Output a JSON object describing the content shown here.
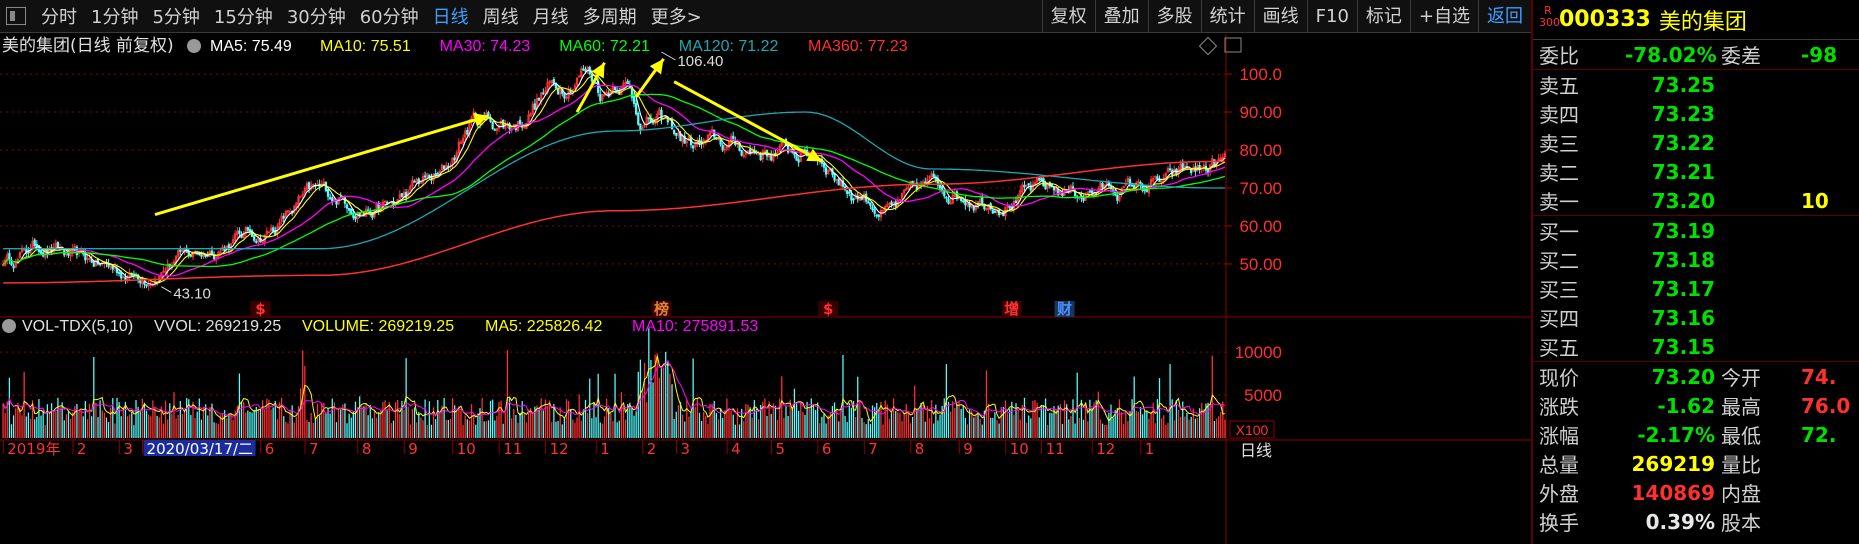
{
  "toolbar": {
    "period_tabs": [
      {
        "label": "分时",
        "active": false
      },
      {
        "label": "1分钟",
        "active": false
      },
      {
        "label": "5分钟",
        "active": false
      },
      {
        "label": "15分钟",
        "active": false
      },
      {
        "label": "30分钟",
        "active": false
      },
      {
        "label": "60分钟",
        "active": false
      },
      {
        "label": "日线",
        "active": true
      },
      {
        "label": "周线",
        "active": false
      },
      {
        "label": "月线",
        "active": false
      },
      {
        "label": "多周期",
        "active": false
      },
      {
        "label": "更多>",
        "active": false
      }
    ],
    "tools": [
      {
        "label": "复权",
        "active": false
      },
      {
        "label": "叠加",
        "active": false
      },
      {
        "label": "多股",
        "active": false
      },
      {
        "label": "统计",
        "active": false
      },
      {
        "label": "画线",
        "active": false
      },
      {
        "label": "F10",
        "active": false
      },
      {
        "label": "标记",
        "active": false
      },
      {
        "label": "+自选",
        "active": false
      },
      {
        "label": "返回",
        "active": true
      }
    ]
  },
  "colors": {
    "ma5": "#ffffff",
    "ma10": "#ffff00",
    "ma30": "#ff00ff",
    "ma60": "#00ff00",
    "ma120": "#1aa9b3",
    "ma360": "#ff3030",
    "up": "#ff3232",
    "down": "#54ffff",
    "grid": "#8b0000",
    "annotation": "#ffff00",
    "green": "#00e000",
    "red": "#ff3030"
  },
  "chart_data": {
    "type": "candlestick",
    "stock_label": "美的集团(日线 前复权)",
    "ma_legend": [
      {
        "label": "MA5: 75.49",
        "key": "ma5"
      },
      {
        "label": "MA10: 75.51",
        "key": "ma10"
      },
      {
        "label": "MA30: 74.23",
        "key": "ma30"
      },
      {
        "label": "MA60: 72.21",
        "key": "ma60"
      },
      {
        "label": "MA120: 71.22",
        "key": "ma120"
      },
      {
        "label": "MA360: 77.23",
        "key": "ma360"
      }
    ],
    "price_ticks": [
      "100.0",
      "90.00",
      "80.00",
      "70.00",
      "60.00",
      "50.00"
    ],
    "price_tick_values": [
      100,
      90,
      80,
      70,
      60,
      50
    ],
    "ylim": [
      40.5,
      109.5
    ],
    "high_label": "106.40",
    "low_label": "43.10",
    "close_anchors": [
      [
        0,
        51
      ],
      [
        18,
        55
      ],
      [
        40,
        50
      ],
      [
        65,
        47
      ],
      [
        85,
        52
      ],
      [
        120,
        58
      ],
      [
        150,
        68
      ],
      [
        180,
        65
      ],
      [
        205,
        72
      ],
      [
        225,
        88
      ],
      [
        240,
        87
      ],
      [
        260,
        96
      ],
      [
        275,
        102
      ],
      [
        285,
        96
      ],
      [
        292,
        100
      ],
      [
        305,
        88
      ],
      [
        330,
        81
      ],
      [
        360,
        80
      ],
      [
        385,
        79
      ],
      [
        405,
        69
      ],
      [
        420,
        64
      ],
      [
        440,
        70
      ],
      [
        470,
        68
      ],
      [
        500,
        69
      ],
      [
        530,
        70
      ],
      [
        550,
        71
      ],
      [
        565,
        74
      ],
      [
        575,
        76
      ]
    ],
    "ma120_anchors": [
      [
        0,
        54
      ],
      [
        150,
        54
      ],
      [
        290,
        85
      ],
      [
        380,
        90
      ],
      [
        440,
        75
      ],
      [
        575,
        70
      ]
    ],
    "ma360_anchors": [
      [
        0,
        45
      ],
      [
        150,
        47
      ],
      [
        290,
        64
      ],
      [
        440,
        71
      ],
      [
        575,
        77
      ]
    ],
    "event_markers": [
      {
        "label": "$",
        "index": 122,
        "color": "#ff3030"
      },
      {
        "label": "榜",
        "index": 312,
        "color": "#e08030"
      },
      {
        "label": "$",
        "index": 391,
        "color": "#ff3030"
      },
      {
        "label": "增",
        "index": 478,
        "color": "#ff3030"
      },
      {
        "label": "财",
        "index": 503,
        "color": "#4a90ff"
      }
    ],
    "arrows": [
      [
        [
          72,
          63
        ],
        [
          230,
          89
        ]
      ],
      [
        [
          272,
          90
        ],
        [
          285,
          103
        ]
      ],
      [
        [
          300,
          94
        ],
        [
          313,
          104
        ]
      ],
      [
        [
          318,
          98
        ],
        [
          388,
          77
        ]
      ]
    ],
    "volume_legend": {
      "title": "VOL-TDX(5,10)",
      "vvol": "VVOL: 269219.25",
      "volume": "VOLUME: 269219.25",
      "ma5": "MA5: 225826.42",
      "ma10": "MA10: 275891.53"
    },
    "volume_ticks": [
      "10000",
      "5000"
    ],
    "volume_tick_values": [
      10000,
      5000
    ],
    "volume_unit": "X100",
    "volume_ylim": [
      0,
      12000
    ],
    "months": [
      {
        "label": "2019年",
        "index": 2
      },
      {
        "label": "2",
        "index": 35
      },
      {
        "label": "3",
        "index": 57
      },
      {
        "label": "2020/03/17/二",
        "index": 68,
        "highlight": true
      },
      {
        "label": "6",
        "index": 124
      },
      {
        "label": "7",
        "index": 145
      },
      {
        "label": "8",
        "index": 170
      },
      {
        "label": "9",
        "index": 192
      },
      {
        "label": "10",
        "index": 215
      },
      {
        "label": "11",
        "index": 237
      },
      {
        "label": "12",
        "index": 259
      },
      {
        "label": "1",
        "index": 283
      },
      {
        "label": "2",
        "index": 305
      },
      {
        "label": "3",
        "index": 321
      },
      {
        "label": "4",
        "index": 345
      },
      {
        "label": "5",
        "index": 366
      },
      {
        "label": "6",
        "index": 388
      },
      {
        "label": "7",
        "index": 410
      },
      {
        "label": "8",
        "index": 432
      },
      {
        "label": "9",
        "index": 455
      },
      {
        "label": "10",
        "index": 477
      },
      {
        "label": "11",
        "index": 494
      },
      {
        "label": "12",
        "index": 518
      },
      {
        "label": "1",
        "index": 541
      }
    ],
    "period_label": "日线"
  },
  "quote": {
    "code": "000333",
    "name": "美的集团",
    "badge": "R 300",
    "weibi": {
      "label": "委比",
      "value": "-78.02%",
      "label2": "委差",
      "value2": "-98"
    },
    "asks": [
      {
        "label": "卖五",
        "price": "73.25",
        "vol": ""
      },
      {
        "label": "卖四",
        "price": "73.23",
        "vol": ""
      },
      {
        "label": "卖三",
        "price": "73.22",
        "vol": ""
      },
      {
        "label": "卖二",
        "price": "73.21",
        "vol": ""
      },
      {
        "label": "卖一",
        "price": "73.20",
        "vol": "10"
      }
    ],
    "bids": [
      {
        "label": "买一",
        "price": "73.19"
      },
      {
        "label": "买二",
        "price": "73.18"
      },
      {
        "label": "买三",
        "price": "73.17"
      },
      {
        "label": "买四",
        "price": "73.16"
      },
      {
        "label": "买五",
        "price": "73.15"
      }
    ],
    "stats": [
      {
        "l1": "现价",
        "v1": "73.20",
        "c1": "green",
        "l2": "今开",
        "v2": "74.",
        "c2": "red"
      },
      {
        "l1": "涨跌",
        "v1": "-1.62",
        "c1": "green",
        "l2": "最高",
        "v2": "76.0",
        "c2": "red"
      },
      {
        "l1": "涨幅",
        "v1": "-2.17%",
        "c1": "green",
        "l2": "最低",
        "v2": "72.",
        "c2": "green"
      },
      {
        "l1": "总量",
        "v1": "269219",
        "c1": "yellow",
        "l2": "量比",
        "v2": "",
        "c2": "red"
      },
      {
        "l1": "外盘",
        "v1": "140869",
        "c1": "red",
        "l2": "内盘",
        "v2": "",
        "c2": "green"
      },
      {
        "l1": "换手",
        "v1": "0.39%",
        "c1": "white",
        "l2": "股本",
        "v2": "",
        "c2": "white"
      }
    ]
  }
}
